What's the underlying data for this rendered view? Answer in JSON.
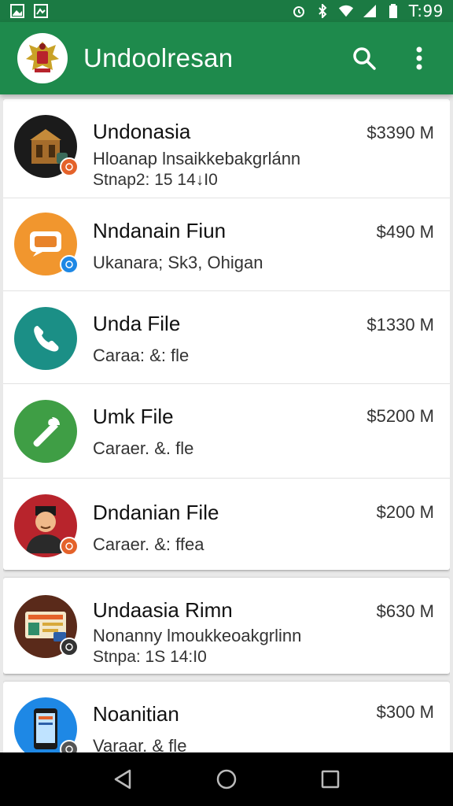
{
  "status_bar": {
    "time": "T:99",
    "icons_left": [
      "image-icon",
      "gallery-icon"
    ],
    "icons_right": [
      "alarm-icon",
      "bluetooth-icon",
      "wifi-icon",
      "signal-icon",
      "battery-icon"
    ]
  },
  "app_bar": {
    "title": "Undoolresan",
    "actions": [
      "search-icon",
      "more-vert-icon"
    ]
  },
  "groups": [
    {
      "rows": [
        {
          "title": "Undonasia",
          "line1": "Hloanap lnsaikkebakgrlánn",
          "line2": "Stnap2: 15 14↓I0",
          "amount": "$3390 M",
          "avatar_bg": "#1b1b1b",
          "badge_bg": "#e4622a",
          "avatar_icon": "building"
        },
        {
          "title": "Nndanain Fiun",
          "line1": "Ukanara; Sk3, Ohigan",
          "line2": "",
          "amount": "$490 M",
          "avatar_bg": "#f1962e",
          "badge_bg": "#1e88e5",
          "avatar_icon": "chat"
        },
        {
          "title": "Unda File",
          "line1": "Caraa: &: fle",
          "line2": "",
          "amount": "$1330 M",
          "avatar_bg": "#1b8f86",
          "badge_bg": "",
          "avatar_icon": "phone"
        },
        {
          "title": "Umk File",
          "line1": "Caraer. &. fle",
          "line2": "",
          "amount": "$5200 M",
          "avatar_bg": "#3f9e45",
          "badge_bg": "",
          "avatar_icon": "wrench"
        },
        {
          "title": "Dndanian File",
          "line1": "Caraer. &: ffea",
          "line2": "",
          "amount": "$200 M",
          "avatar_bg": "#b8242c",
          "badge_bg": "#e4622a",
          "avatar_icon": "person"
        }
      ]
    },
    {
      "rows": [
        {
          "title": "Undaasia Rimn",
          "line1": "Nonanny lmoukkeoakgrlinn",
          "line2": "Stnpa: 1S 14:I0",
          "amount": "$630 M",
          "avatar_bg": "#5a2a1a",
          "badge_bg": "#333333",
          "avatar_icon": "screen"
        }
      ]
    },
    {
      "rows": [
        {
          "title": "Noanitian",
          "line1": "Varaar. & fle",
          "line2": "",
          "amount": "$300 M",
          "avatar_bg": "#1e88e5",
          "badge_bg": "#555555",
          "avatar_icon": "device"
        }
      ]
    }
  ],
  "nav_bar": [
    "back-icon",
    "home-icon",
    "recents-icon"
  ]
}
